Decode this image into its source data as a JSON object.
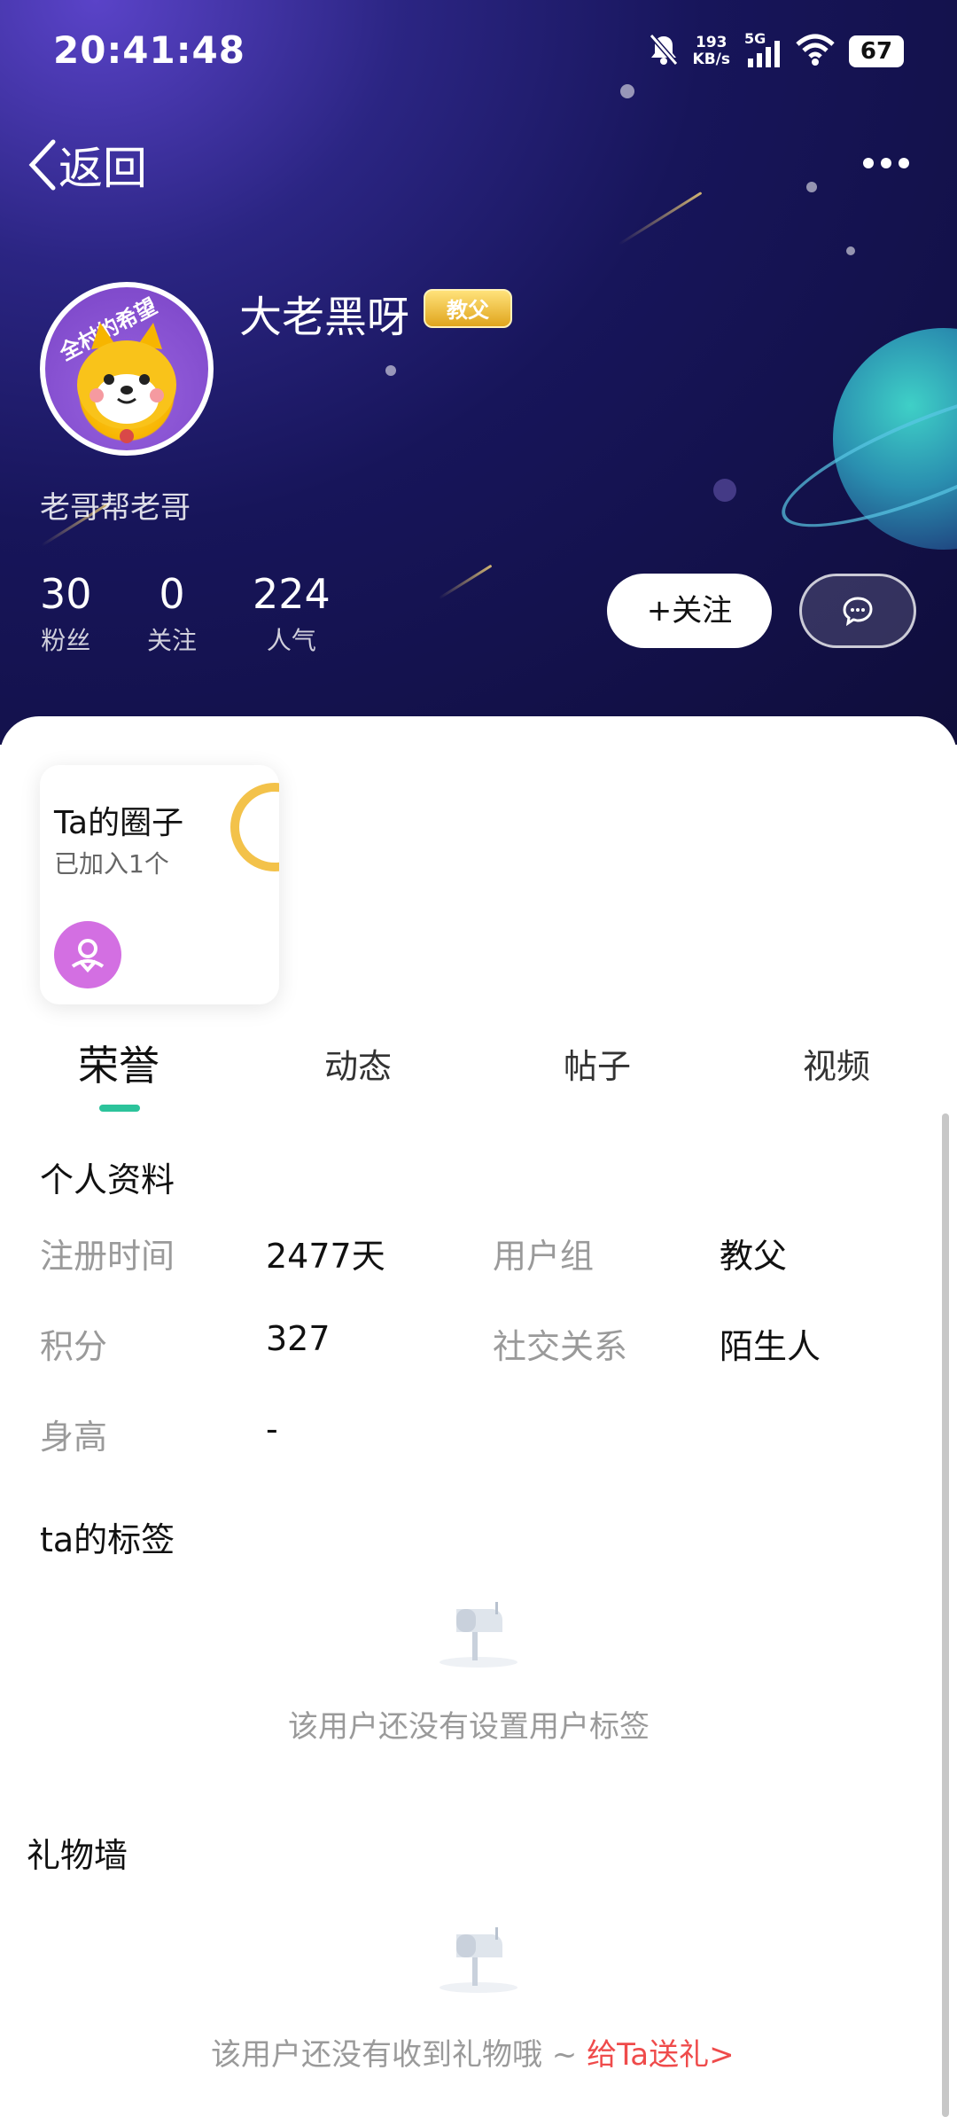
{
  "status_bar": {
    "time": "20:41:48",
    "net_speed_value": "193",
    "net_speed_unit": "KB/s",
    "network": "5G",
    "battery": "67"
  },
  "nav": {
    "back_label": "返回"
  },
  "profile": {
    "username": "大老黑呀",
    "badge": "教父",
    "avatar_text": "全村的希望",
    "bio": "老哥帮老哥",
    "stats": [
      {
        "value": "30",
        "label": "粉丝"
      },
      {
        "value": "0",
        "label": "关注"
      },
      {
        "value": "224",
        "label": "人气"
      }
    ],
    "follow_label": "+关注"
  },
  "circle_card": {
    "title": "Ta的圈子",
    "subtitle": "已加入1个"
  },
  "tabs": [
    {
      "label": "荣誉",
      "active": true
    },
    {
      "label": "动态",
      "active": false
    },
    {
      "label": "帖子",
      "active": false
    },
    {
      "label": "视频",
      "active": false
    }
  ],
  "personal_info": {
    "title": "个人资料",
    "rows": [
      {
        "label": "注册时间",
        "value": "2477天"
      },
      {
        "label": "用户组",
        "value": "教父"
      },
      {
        "label": "积分",
        "value": "327"
      },
      {
        "label": "社交关系",
        "value": "陌生人"
      },
      {
        "label": "身高",
        "value": "-"
      }
    ]
  },
  "tags": {
    "title": "ta的标签",
    "empty_text": "该用户还没有设置用户标签"
  },
  "gift_wall": {
    "title": "礼物墙",
    "empty_text": "该用户还没有收到礼物哦 ~ ",
    "gift_link": "给Ta送礼>"
  },
  "colors": {
    "accent_tab": "#2cc39b",
    "gift_link": "#ef4b4b",
    "badge_gold": "#e0a51d",
    "hero_bg": "#17155a"
  }
}
